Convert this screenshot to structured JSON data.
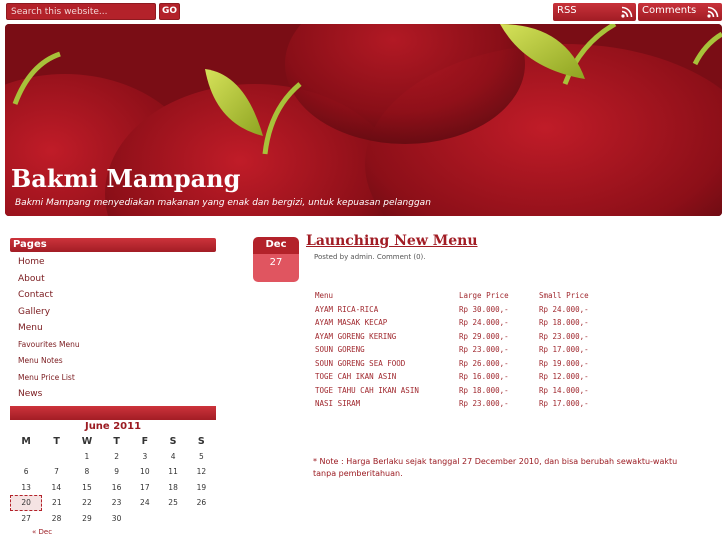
{
  "topbar": {
    "search_placeholder": "Search this website...",
    "go_label": "GO",
    "rss_label": "RSS",
    "comments_label": "Comments"
  },
  "header": {
    "site_title": "Bakmi Mampang",
    "tagline": "Bakmi Mampang menyediakan makanan yang enak dan bergizi, untuk kepuasan pelanggan"
  },
  "sidebar": {
    "pages_title": "Pages",
    "pages": [
      "Home",
      "About",
      "Contact",
      "Gallery",
      "Menu",
      "Favourites Menu",
      "Menu Notes",
      "Menu Price List",
      "News"
    ]
  },
  "calendar": {
    "month": "June 2011",
    "weekdays": [
      "M",
      "T",
      "W",
      "T",
      "F",
      "S",
      "S"
    ],
    "weeks": [
      [
        "",
        "",
        "1",
        "2",
        "3",
        "4",
        "5"
      ],
      [
        "6",
        "7",
        "8",
        "9",
        "10",
        "11",
        "12"
      ],
      [
        "13",
        "14",
        "15",
        "16",
        "17",
        "18",
        "19"
      ],
      [
        "20",
        "21",
        "22",
        "23",
        "24",
        "25",
        "26"
      ],
      [
        "27",
        "28",
        "29",
        "30",
        "",
        "",
        ""
      ]
    ],
    "today": "20",
    "prev_link": "« Dec"
  },
  "post": {
    "date_month": "Dec",
    "date_day": "27",
    "title": "Launching New Menu",
    "meta": "Posted by admin. Comment (0).",
    "table_headers": [
      "Menu",
      "Large Price",
      "Small Price"
    ],
    "rows": [
      [
        "AYAM RICA-RICA",
        "Rp 30.000,-",
        "Rp 24.000,-"
      ],
      [
        "AYAM MASAK KECAP",
        "Rp 24.000,-",
        "Rp 18.000,-"
      ],
      [
        "AYAM GORENG KERING",
        "Rp 29.000,-",
        "Rp 23.000,-"
      ],
      [
        "SOUN GORENG",
        "Rp 23.000,-",
        "Rp 17.000,-"
      ],
      [
        "SOUN GORENG SEA FOOD",
        "Rp 26.000,-",
        "Rp 19.000,-"
      ],
      [
        "TOGE CAH IKAN ASIN",
        "Rp 16.000,-",
        "Rp 12.000,-"
      ],
      [
        "TOGE TAHU CAH IKAN ASIN",
        "Rp 18.000,-",
        "Rp 14.000,-"
      ],
      [
        "NASI SIRAM",
        "Rp 23.000,-",
        "Rp 17.000,-"
      ]
    ],
    "note": "* Note : Harga Berlaku sejak tanggal 27 December 2010, dan bisa berubah sewaktu-waktu tanpa pemberitahuan."
  },
  "colors": {
    "accent": "#b3222a",
    "header_bg": "#8a1019",
    "leaf": "#b6cc3a"
  },
  "icons": [
    "rss-icon",
    "apple-illustration"
  ]
}
